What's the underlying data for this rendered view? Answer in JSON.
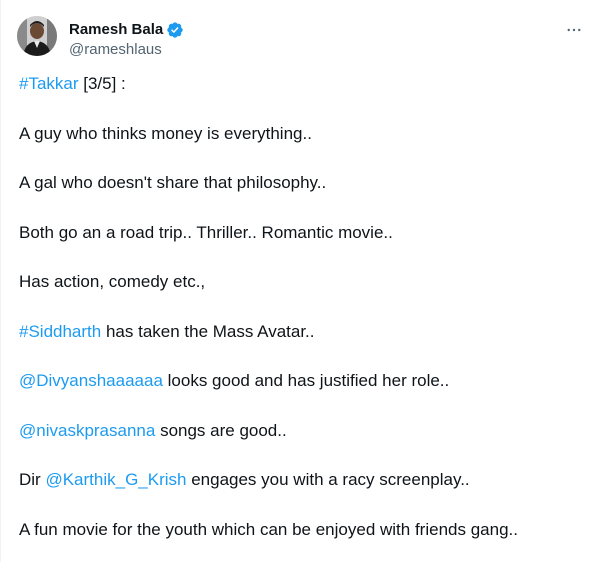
{
  "author": {
    "display_name": "Ramesh Bala",
    "handle": "@rameshlaus",
    "verified": true,
    "verified_color": "#1d9bf0"
  },
  "more_icon": "more-horizontal-icon",
  "lines": [
    {
      "link": "#Takkar",
      "text": " [3/5] :"
    },
    {
      "pre": "A guy who thinks money is everything.."
    },
    {
      "pre": "A gal who doesn't share that philosophy.."
    },
    {
      "pre": "Both go an a road trip.. Thriller.. Romantic movie.."
    },
    {
      "pre": "Has action, comedy etc.,"
    },
    {
      "link": "#Siddharth",
      "text": " has taken the Mass Avatar.."
    },
    {
      "link": "@Divyanshaaaaaa",
      "text": " looks good and has justified her role.."
    },
    {
      "link": "@nivaskprasanna",
      "text": " songs are good.."
    },
    {
      "pre": "Dir ",
      "link": "@Karthik_G_Krish",
      "text": " engages you with a racy screenplay.."
    },
    {
      "pre": "A fun movie for the youth which can be enjoyed with friends gang.."
    }
  ],
  "colors": {
    "link": "#1d9bf0",
    "text": "#0f1419",
    "secondary": "#536471"
  }
}
